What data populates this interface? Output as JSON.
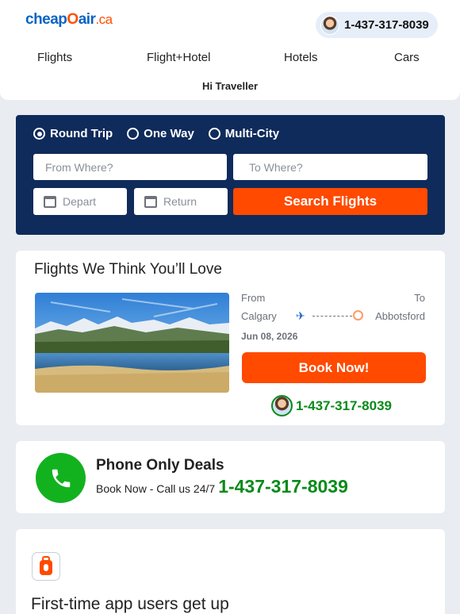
{
  "header": {
    "logo": {
      "part1": "cheap",
      "part2": "O",
      "part3": "air",
      "part4": ".ca"
    },
    "phone": "1-437-317-8039",
    "nav": [
      "Flights",
      "Flight+Hotel",
      "Hotels",
      "Cars"
    ],
    "greeting": "Hi Traveller"
  },
  "search": {
    "trip_types": [
      {
        "label": "Round Trip",
        "selected": true
      },
      {
        "label": "One Way",
        "selected": false
      },
      {
        "label": "Multi-City",
        "selected": false
      }
    ],
    "from_placeholder": "From Where?",
    "to_placeholder": "To Where?",
    "depart_placeholder": "Depart",
    "return_placeholder": "Return",
    "button": "Search Flights"
  },
  "deal": {
    "title": "Flights We Think You’ll Love",
    "from_label": "From",
    "to_label": "To",
    "from_city": "Calgary",
    "to_city": "Abbotsford",
    "date": "Jun 08, 2026",
    "button": "Book Now!",
    "phone": "1-437-317-8039"
  },
  "phone_deals": {
    "title": "Phone Only Deals",
    "subtitle": "Book Now - Call us 24/7",
    "phone": "1-437-317-8039"
  },
  "app_promo": {
    "text": "First-time app users get up"
  },
  "colors": {
    "brand_blue": "#0b63c4",
    "brand_orange": "#ff4a00",
    "navy": "#0f2b5b",
    "green": "#0a8a1a"
  }
}
